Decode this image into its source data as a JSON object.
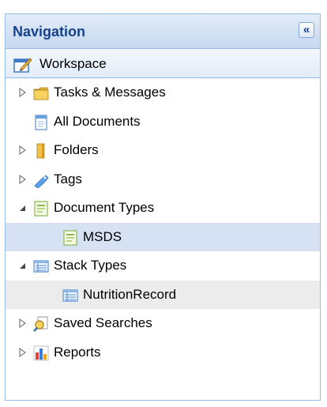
{
  "navigation": {
    "title": "Navigation",
    "collapse_glyph": "«",
    "workspace_label": "Workspace",
    "items": [
      {
        "label": "Tasks & Messages",
        "icon": "folder-icon",
        "expanded": false
      },
      {
        "label": "All Documents",
        "icon": "document-icon"
      },
      {
        "label": "Folders",
        "icon": "folders-icon",
        "expanded": false
      },
      {
        "label": "Tags",
        "icon": "tag-icon",
        "expanded": false
      },
      {
        "label": "Document Types",
        "icon": "document-type-icon",
        "expanded": true
      },
      {
        "label": "MSDS",
        "icon": "document-type-icon",
        "selected": true
      },
      {
        "label": "Stack Types",
        "icon": "stack-type-icon",
        "expanded": true
      },
      {
        "label": "NutritionRecord",
        "icon": "stack-type-icon",
        "hovered": true
      },
      {
        "label": "Saved Searches",
        "icon": "saved-search-icon",
        "expanded": false
      },
      {
        "label": "Reports",
        "icon": "report-icon",
        "expanded": false
      }
    ]
  },
  "colors": {
    "header_text": "#15428b",
    "border": "#99bbe8",
    "selected_row": "#d6e2f3",
    "hover_row": "#ececec"
  }
}
